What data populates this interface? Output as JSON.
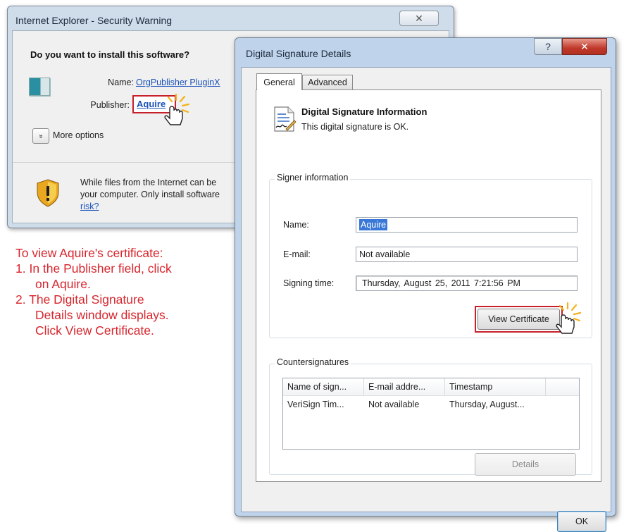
{
  "security_warning": {
    "title": "Internet Explorer - Security Warning",
    "close_glyph": "✕",
    "question": "Do you want to install this software?",
    "name_label": "Name:",
    "name_value": "OrgPublisher PluginX",
    "publisher_label": "Publisher:",
    "publisher_value": "Aquire",
    "more_options_glyph": "»",
    "more_options_label": "More options",
    "warning_line1": "While files from the Internet can be",
    "warning_line2": "your computer. Only install software",
    "warning_link": "risk?"
  },
  "instructions": {
    "line1": "To view Aquire's certificate:",
    "line2": "1. In the Publisher field, click",
    "line3": "on Aquire.",
    "line4": "2. The Digital Signature",
    "line5": "Details window displays.",
    "line6": "Click View Certificate."
  },
  "signature_details": {
    "title": "Digital Signature Details",
    "help_glyph": "?",
    "close_glyph": "✕",
    "tabs": [
      {
        "label": "General"
      },
      {
        "label": "Advanced"
      }
    ],
    "info_title": "Digital Signature Information",
    "info_status": "This digital signature is OK.",
    "signer_group_label": "Signer information",
    "name_label": "Name:",
    "name_value": "Aquire",
    "email_label": "E-mail:",
    "email_value": "Not available",
    "signing_time_label": "Signing time:",
    "signing_time_value": "Thursday,  August  25,  2011 7:21:56 PM",
    "view_certificate_label": "View Certificate",
    "countersignatures_label": "Countersignatures",
    "columns": [
      "Name of sign...",
      "E-mail addre...",
      "Timestamp"
    ],
    "rows": [
      [
        "VeriSign Tim...",
        "Not available",
        "Thursday, August..."
      ]
    ],
    "details_label": "Details",
    "ok_label": "OK"
  },
  "colors": {
    "highlight_red": "#c6202a",
    "instruction_red": "#d7262d",
    "link_blue": "#1a52b8"
  }
}
